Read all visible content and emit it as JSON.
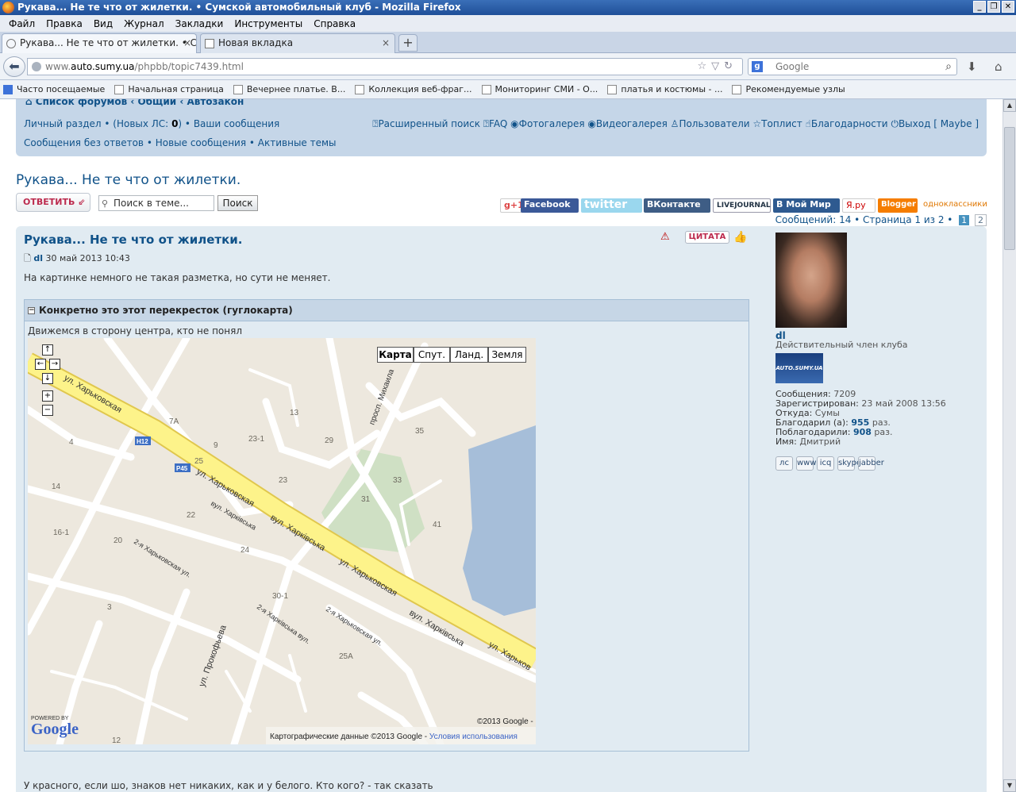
{
  "window": {
    "title": "Рукава... Не те что от жилетки. • Сумской автомобильный клуб - Mozilla Firefox"
  },
  "menu": [
    "Файл",
    "Правка",
    "Вид",
    "Журнал",
    "Закладки",
    "Инструменты",
    "Справка"
  ],
  "tabs": [
    {
      "label": "Рукава... Не те что от жилетки. • Сум...",
      "close": "×"
    },
    {
      "label": "Новая вкладка",
      "close": "×"
    }
  ],
  "newtab": "+",
  "url": {
    "prefix": "www.",
    "domain": "auto.sumy.ua",
    "path": "/phpbb/topic7439.html"
  },
  "search": {
    "engine": "g",
    "placeholder": "Google"
  },
  "bookmarks": [
    "Часто посещаемые",
    "Начальная страница",
    "Вечернее платье. В...",
    "Коллекция веб-фраг...",
    "Мониторинг СМИ - О...",
    "платья и костюмы - ...",
    "Рекомендуемые узлы"
  ],
  "forum": {
    "crumbs": "Список форумов ‹ Общий ‹ Автозакон",
    "nav1_a": "Личный раздел",
    "nav1_b": "(Новых ЛС:",
    "nav1_count": "0",
    "nav1_c": ")",
    "nav1_d": "Ваши сообщения",
    "nav2_a": "Сообщения без ответов",
    "nav2_b": "Новые сообщения",
    "nav2_c": "Активные темы",
    "navr": [
      "Расширенный поиск",
      "FAQ",
      "Фотогалерея",
      "Видеогалерея",
      "Пользователи",
      "Топлист",
      "Благодарности",
      "Выход [ Maybe ]"
    ],
    "topic_title": "Рукава... Не те что от жилетки.",
    "reply": "ОТВЕТИТЬ",
    "search_placeholder": "Поиск в теме...",
    "search_button": "Поиск",
    "share": [
      "Facebook",
      "twitter",
      "ВКонтакте",
      "LIVEJOURNAL",
      "В Мой Мир",
      "Я.ру",
      "Blogger",
      "одноклассники"
    ],
    "pageinfo": "Сообщений: 14 • Страница 1 из 2 •",
    "page_current": "1",
    "page_next": "2"
  },
  "post": {
    "title": "Рукава... Не те что от жилетки.",
    "author": "dl",
    "date": "30 май 2013 10:43",
    "body": "На картинке немного не такая разметка, но сути не меняет.",
    "quote": "ЦИТАТА",
    "spoiler_title": "Конкретно это этот перекресток (гуглокарта)",
    "spoiler_text": "Движемся в сторону центра, кто не понял",
    "after_text": "У красного, если шо, знаков нет никаких, как и у белого. Кто кого? - так сказать"
  },
  "map": {
    "types": [
      "Карта",
      "Спут.",
      "Ланд.",
      "Земля"
    ],
    "street1": "ул. Харьковская",
    "street2": "вул. Харківська",
    "street3": "ул. Харьковская",
    "street4": "вул. Харківська",
    "street5": "ул. Харьков",
    "street6": "ул. Харьковская",
    "street7": "вул. Харківська",
    "street8": "2-я Харьковская ул.",
    "street9": "ул. Прокофьева",
    "street10": "просп. Михаила",
    "street11": "2-я Харківська вул.",
    "street12": "2-я Харьковская ул.",
    "badge1": "H12",
    "badge2": "P45",
    "numbers": [
      "13",
      "7А",
      "9",
      "23-1",
      "29",
      "35",
      "33",
      "31",
      "41",
      "23",
      "22",
      "25",
      "24",
      "20",
      "16-1",
      "14",
      "4",
      "30-1",
      "3",
      "25А",
      "12"
    ],
    "copyright": "©2013 Google -",
    "mapdata": "Картографические данные ©2013 Google -",
    "terms": "Условия использования",
    "powered": "POWERED BY",
    "google": "Google"
  },
  "profile": {
    "name": "dl",
    "rank": "Действительный член клуба",
    "rank_img": "AUTO.SUMY.UA",
    "posts_label": "Сообщения:",
    "posts": "7209",
    "reg_label": "Зарегистрирован:",
    "reg": "23 май 2008 13:56",
    "from_label": "Откуда:",
    "from": "Сумы",
    "thanked_label": "Благодарил (а):",
    "thanked": "955",
    "thanked_unit": "раз.",
    "thanks_label": "Поблагодарили:",
    "thanks": "908",
    "thanks_unit": "раз.",
    "name_label": "Имя:",
    "realname": "Дмитрий",
    "icons": [
      "лс",
      "www",
      "icq",
      "skype",
      "jabber"
    ]
  }
}
